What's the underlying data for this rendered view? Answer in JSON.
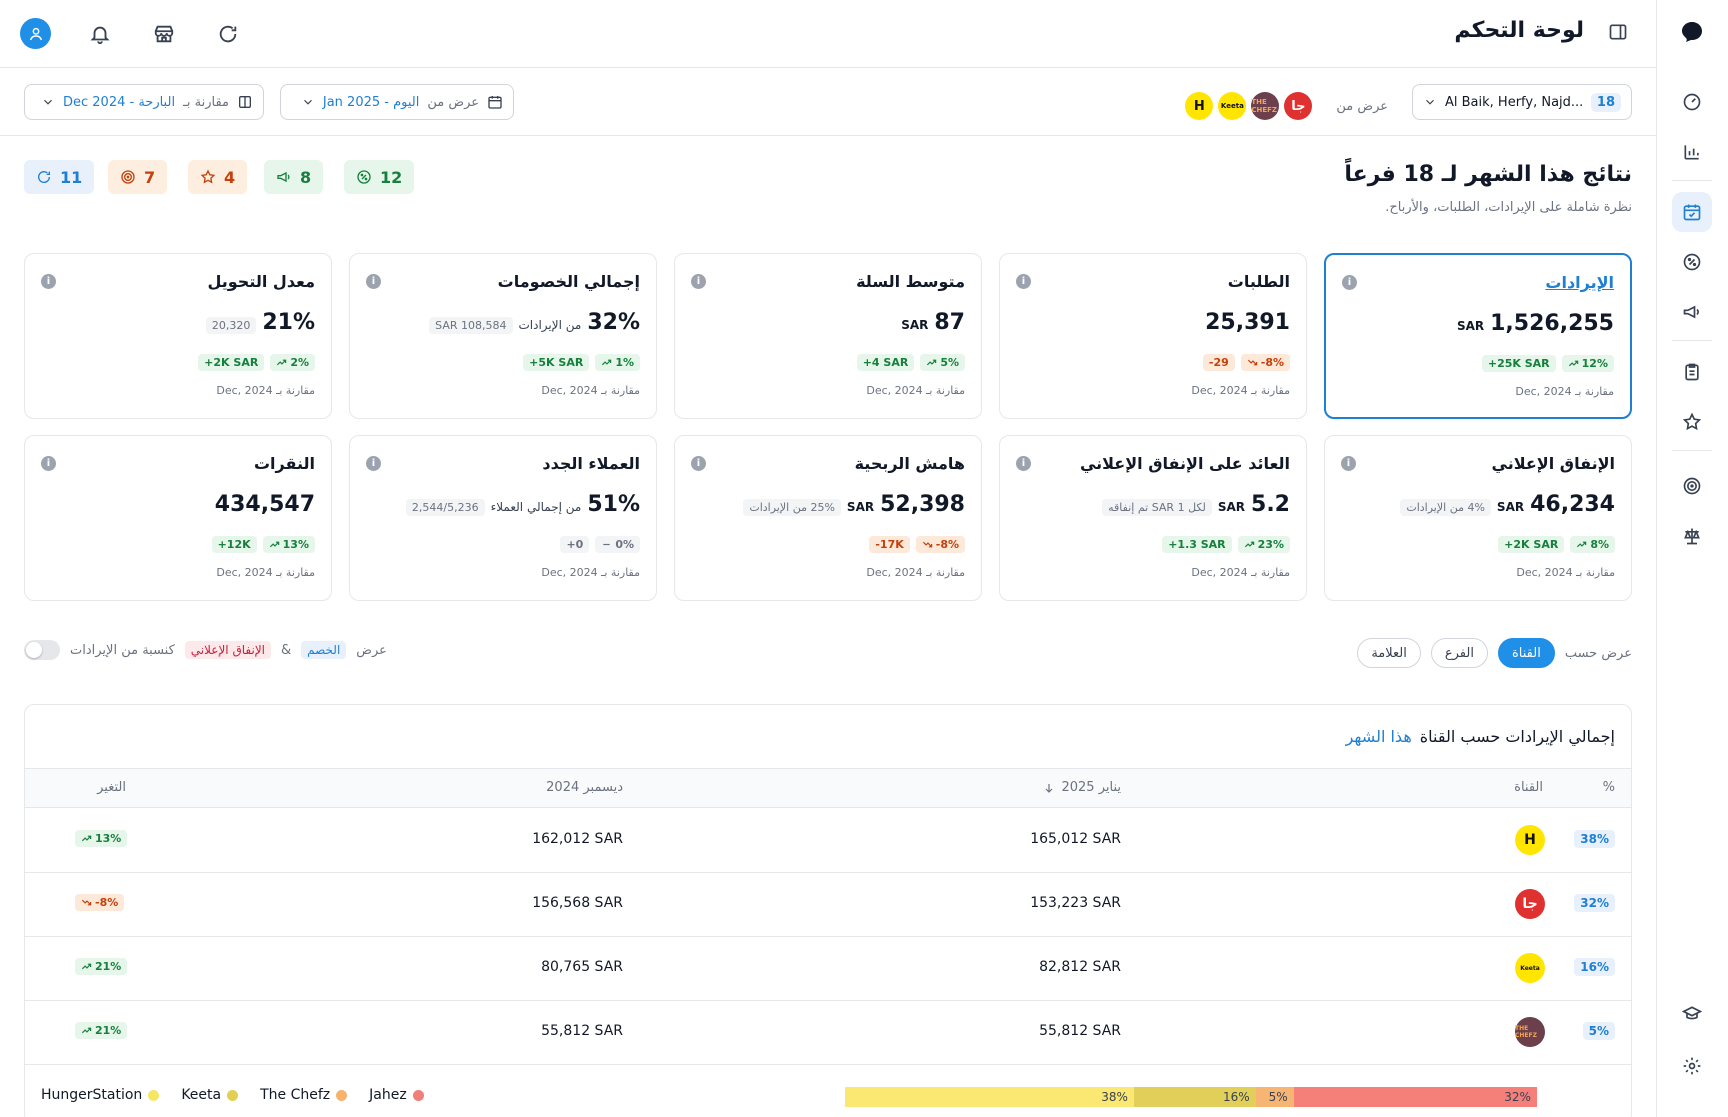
{
  "header": {
    "title": "لوحة التحكم"
  },
  "filters": {
    "branch_count": "18",
    "branches": "Al Baik, Herfy, Najd...",
    "channels_label": "عرض من",
    "channel_logos": [
      {
        "name": "Jahez",
        "text": "جا",
        "bg": "#e03131",
        "fg": "#ffffff"
      },
      {
        "name": "The Chefz",
        "text": "THE CHEFZ",
        "bg": "#6b3f4c",
        "fg": "#f4a64a"
      },
      {
        "name": "Keeta",
        "text": "Keeta",
        "bg": "#ffe500",
        "fg": "#111111"
      },
      {
        "name": "HungerStation",
        "text": "H",
        "bg": "#ffe500",
        "fg": "#111111"
      }
    ],
    "date_label": "عرض من",
    "date_value": "اليوم - Jan 2025",
    "compare_label": "مقارنة بـ",
    "compare_value": "البارحة - Dec 2024"
  },
  "overview": {
    "title": "نتائج هذا الشهر لـ 18 فرعاً",
    "subtitle": "نظرة شاملة على الإيرادات، الطلبات، والأرباح.",
    "badges": [
      {
        "name": "discounts",
        "icon": "percent-badge-icon",
        "value": "12",
        "bg": "#e6f6ea",
        "fg": "#16803c"
      },
      {
        "name": "campaigns",
        "icon": "megaphone-icon",
        "value": "8",
        "bg": "#e6f6ea",
        "fg": "#16803c"
      },
      {
        "name": "reviews",
        "icon": "star-icon",
        "value": "4",
        "bg": "#fdeee0",
        "fg": "#c2410c"
      },
      {
        "name": "targets",
        "icon": "target-icon",
        "value": "7",
        "bg": "#fdeee0",
        "fg": "#c2410c"
      },
      {
        "name": "refresh",
        "icon": "refresh-icon",
        "value": "11",
        "bg": "#e8f1fb",
        "fg": "#1f7fd1"
      }
    ]
  },
  "kpis": [
    {
      "title": "الإيرادات",
      "value": "1,526,255",
      "unit": "SAR",
      "note": "",
      "tag": "",
      "delta_pct": "12%",
      "delta_pct_dir": "up",
      "delta_abs": "+25K SAR",
      "delta_abs_dir": "up",
      "compare": "مقارنة بـ Dec, 2024"
    },
    {
      "title": "الطلبات",
      "value": "25,391",
      "unit": "",
      "note": "",
      "tag": "",
      "delta_pct": "-8%",
      "delta_pct_dir": "down",
      "delta_abs": "-29",
      "delta_abs_dir": "down",
      "compare": "مقارنة بـ Dec, 2024"
    },
    {
      "title": "متوسط السلة",
      "value": "87",
      "unit": "SAR",
      "note": "",
      "tag": "",
      "delta_pct": "5%",
      "delta_pct_dir": "up",
      "delta_abs": "+4 SAR",
      "delta_abs_dir": "up",
      "compare": "مقارنة بـ Dec, 2024"
    },
    {
      "title": "إجمالي الخصومات",
      "value": "32%",
      "unit": "",
      "note": "من الإيرادات",
      "tag": "108,584 SAR",
      "delta_pct": "1%",
      "delta_pct_dir": "up",
      "delta_abs": "+5K SAR",
      "delta_abs_dir": "up",
      "compare": "مقارنة بـ Dec, 2024"
    },
    {
      "title": "معدل التحويل",
      "value": "21%",
      "unit": "",
      "note": "",
      "tag": "20,320",
      "delta_pct": "2%",
      "delta_pct_dir": "up",
      "delta_abs": "+2K SAR",
      "delta_abs_dir": "up",
      "compare": "مقارنة بـ Dec, 2024"
    },
    {
      "title": "الإنفاق الإعلاني",
      "value": "46,234",
      "unit": "SAR",
      "note": "",
      "tag": "4% من الإيرادات",
      "delta_pct": "8%",
      "delta_pct_dir": "up",
      "delta_abs": "+2K SAR",
      "delta_abs_dir": "up",
      "compare": "مقارنة بـ Dec, 2024"
    },
    {
      "title": "العائد على الإنفاق الإعلاني",
      "value": "5.2",
      "unit": "SAR",
      "note": "",
      "tag": "لكل 1 SAR تم إنفاقه",
      "delta_pct": "23%",
      "delta_pct_dir": "up",
      "delta_abs": "+1.3 SAR",
      "delta_abs_dir": "up",
      "compare": "مقارنة بـ Dec, 2024"
    },
    {
      "title": "هامش الربحية",
      "value": "52,398",
      "unit": "SAR",
      "note": "",
      "tag": "25% من الإيرادات",
      "delta_pct": "-8%",
      "delta_pct_dir": "down",
      "delta_abs": "-17K",
      "delta_abs_dir": "down",
      "compare": "مقارنة بـ Dec, 2024"
    },
    {
      "title": "العملاء الجدد",
      "value": "51%",
      "unit": "",
      "note": "من إجمالي العملاء",
      "tag": "2,544/5,236",
      "delta_pct": "0%",
      "delta_pct_dir": "flat",
      "delta_abs": "+0",
      "delta_abs_dir": "flat",
      "compare": "مقارنة بـ Dec, 2024"
    },
    {
      "title": "النقرات",
      "value": "434,547",
      "unit": "",
      "note": "",
      "tag": "",
      "delta_pct": "13%",
      "delta_pct_dir": "up",
      "delta_abs": "+12K",
      "delta_abs_dir": "up",
      "compare": "مقارنة بـ Dec, 2024"
    }
  ],
  "groupby": {
    "label": "عرض حسب",
    "options": [
      "القناة",
      "الفرع",
      "العلامة"
    ]
  },
  "show": {
    "label": "عرض",
    "discount": "الخصم",
    "and": "&",
    "ad_spend": "الإنفاق الإعلاني",
    "suffix": "كنسبة من الإيرادات"
  },
  "table": {
    "title": "إجمالي الإيرادات حسب القناة",
    "period": "هذا الشهر",
    "columns": {
      "pct": "%",
      "channel": "القناة",
      "current": "يناير 2025",
      "previous": "ديسمبر 2024",
      "change": "التغير"
    },
    "rows": [
      {
        "pct": "38%",
        "logo_text": "H",
        "logo_bg": "#ffe500",
        "logo_fg": "#111111",
        "current": "165,012 SAR",
        "previous": "162,012 SAR",
        "change": "13%",
        "dir": "up"
      },
      {
        "pct": "32%",
        "logo_text": "جا",
        "logo_bg": "#e03131",
        "logo_fg": "#ffffff",
        "current": "153,223 SAR",
        "previous": "156,568 SAR",
        "change": "-8%",
        "dir": "down"
      },
      {
        "pct": "16%",
        "logo_text": "Keeta",
        "logo_bg": "#ffe500",
        "logo_fg": "#111111",
        "current": "82,812 SAR",
        "previous": "80,765 SAR",
        "change": "21%",
        "dir": "up"
      },
      {
        "pct": "5%",
        "logo_text": "THE CHEFZ",
        "logo_bg": "#6b3f4c",
        "logo_fg": "#f4a64a",
        "current": "55,812 SAR",
        "previous": "55,812 SAR",
        "change": "21%",
        "dir": "up"
      }
    ],
    "legend": [
      {
        "name": "HungerStation",
        "color": "#f5e663"
      },
      {
        "name": "Keeta",
        "color": "#e2cf55"
      },
      {
        "name": "The Chefz",
        "color": "#f5b36b"
      },
      {
        "name": "Jahez",
        "color": "#f07f7a"
      }
    ],
    "share_bar": [
      {
        "label": "38%",
        "share": 38,
        "color": "#fbe873"
      },
      {
        "label": "16%",
        "share": 16,
        "color": "#e2cf5a"
      },
      {
        "label": "5%",
        "share": 5,
        "color": "#f6b573"
      },
      {
        "label": "32%",
        "share": 32,
        "color": "#f57f79"
      }
    ]
  }
}
